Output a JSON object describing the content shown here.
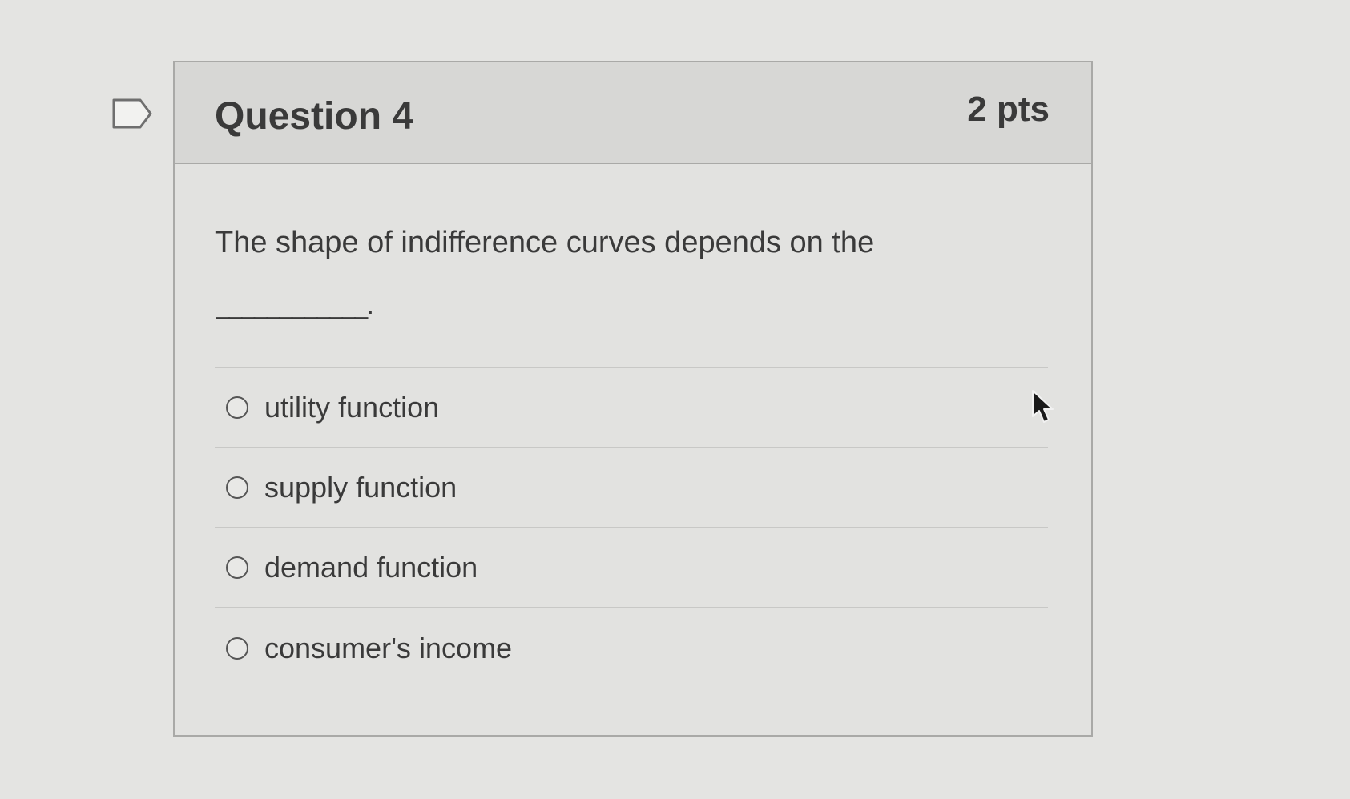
{
  "question": {
    "title": "Question 4",
    "points": "2 pts",
    "text": "The shape of indifference curves depends on the",
    "blank": "____________."
  },
  "answers": [
    {
      "label": "utility function",
      "selected": false
    },
    {
      "label": "supply function",
      "selected": false
    },
    {
      "label": "demand function",
      "selected": false
    },
    {
      "label": "consumer's income",
      "selected": false
    }
  ],
  "icons": {
    "flag": "flag-question-icon",
    "cursor": "mouse-pointer-icon"
  }
}
